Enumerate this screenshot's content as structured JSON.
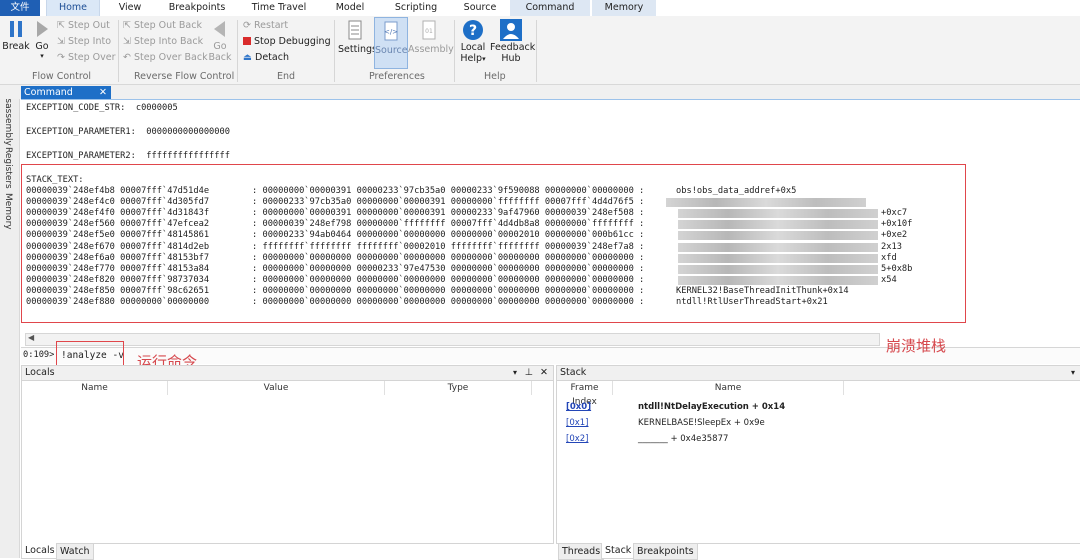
{
  "menu_tabs": {
    "file": "文件",
    "home": "Home",
    "view": "View",
    "breakpoints": "Breakpoints",
    "time_travel": "Time Travel",
    "model": "Model",
    "scripting": "Scripting",
    "source": "Source",
    "command": "Command",
    "memory": "Memory"
  },
  "ribbon": {
    "break": "Break",
    "go": "Go",
    "step_out": "Step Out",
    "step_into": "Step Into",
    "step_over": "Step Over",
    "step_out_back": "Step Out Back",
    "step_into_back": "Step Into Back",
    "step_over_back": "Step Over Back",
    "go_back_1": "Go",
    "go_back_2": "Back",
    "restart": "Restart",
    "stop_debugging": "Stop Debugging",
    "detach": "Detach",
    "settings": "Settings",
    "source": "Source",
    "assembly": "Assembly",
    "local_help_1": "Local",
    "local_help_2": "Help",
    "feedback_hub_1": "Feedback",
    "feedback_hub_2": "Hub",
    "groups": {
      "flow_control": "Flow Control",
      "reverse_flow_control": "Reverse Flow Control",
      "end": "End",
      "preferences": "Preferences",
      "help": "Help"
    }
  },
  "side_tabs": {
    "disassembly": "Disassembly",
    "registers": "Registers",
    "memory": "Memory"
  },
  "command_window": {
    "tab_title": "Command",
    "lines": [
      "EXCEPTION_CODE_STR:  c0000005",
      "",
      "EXCEPTION_PARAMETER1:  0000000000000000",
      "",
      "EXCEPTION_PARAMETER2:  ffffffffffffffff",
      "",
      "STACK_TEXT:"
    ],
    "stack_rows": [
      {
        "addr": "00000039`248ef4b8 00007fff`47d51d4e",
        "args": ": 00000000`00000391 00000233`97cb35a0 00000233`9f590088 00000000`00000000 :",
        "sym": "obs!obs_data_addref+0x5",
        "blur": false
      },
      {
        "addr": "00000039`248ef4c0 00007fff`4d305fd7",
        "args": ": 00000233`97cb35a0 00000000`00000391 00000000`ffffffff 00007fff`4d4d76f5 :",
        "sym": "",
        "blur": true
      },
      {
        "addr": "00000039`248ef4f0 00007fff`4d31843f",
        "args": ": 00000000`00000391 00000000`00000391 00000233`9af47960 00000039`248ef508 :",
        "sym": "+0xc7",
        "blur": true
      },
      {
        "addr": "00000039`248ef560 00007fff`47efcea2",
        "args": ": 00000039`248ef798 00000000`ffffffff 00007fff`4d4db8a8 00000000`ffffffff :",
        "sym": "+0x10f",
        "blur": true
      },
      {
        "addr": "00000039`248ef5e0 00007fff`48145861",
        "args": ": 00000233`94ab0464 00000000`00000000 00000000`00002010 00000000`000b61cc :",
        "sym": "+0xe2",
        "blur": true
      },
      {
        "addr": "00000039`248ef670 00007fff`4814d2eb",
        "args": ": ffffffff`ffffffff ffffffff`00002010 ffffffff`ffffffff 00000039`248ef7a8 :",
        "sym": "2x13",
        "blur": true
      },
      {
        "addr": "00000039`248ef6a0 00007fff`48153bf7",
        "args": ": 00000000`00000000 00000000`00000000 00000000`00000000 00000000`00000000 :",
        "sym": "xfd",
        "blur": true
      },
      {
        "addr": "00000039`248ef770 00007fff`48153a84",
        "args": ": 00000000`00000000 00000233`97e47530 00000000`00000000 00000000`00000000 :",
        "sym": "5+0x8b",
        "blur": true
      },
      {
        "addr": "00000039`248ef820 00007fff`98737034",
        "args": ": 00000000`00000000 00000000`00000000 00000000`00000000 00000000`00000000 :",
        "sym": "x54",
        "blur": true
      },
      {
        "addr": "00000039`248ef850 00007fff`98c62651",
        "args": ": 00000000`00000000 00000000`00000000 00000000`00000000 00000000`00000000 :",
        "sym": "KERNEL32!BaseThreadInitThunk+0x14",
        "blur": false
      },
      {
        "addr": "00000039`248ef880 00000000`00000000",
        "args": ": 00000000`00000000 00000000`00000000 00000000`00000000 00000000`00000000 :",
        "sym": "ntdll!RtlUserThreadStart+0x21",
        "blur": false
      }
    ],
    "prompt": "0:109>",
    "input_value": "!analyze -v"
  },
  "annotations": {
    "run_command": "运行命令",
    "crash_stack": "崩溃堆栈"
  },
  "locals_pane": {
    "title": "Locals",
    "columns": [
      "Name",
      "Value",
      "Type"
    ],
    "tabs": [
      "Locals",
      "Watch"
    ]
  },
  "stack_pane": {
    "title": "Stack",
    "columns": [
      "Frame Index",
      "Name"
    ],
    "rows": [
      {
        "index": "[0x0]",
        "name": "ntdll!NtDelayExecution + 0x14"
      },
      {
        "index": "[0x1]",
        "name": "KERNELBASE!SleepEx + 0x9e"
      },
      {
        "index": "[0x2]",
        "name": "_______ + 0x4e35877"
      }
    ],
    "tabs": [
      "Threads",
      "Stack",
      "Breakpoints"
    ]
  },
  "colors": {
    "accent": "#1f5fb4",
    "highlight_box": "#e0464b",
    "link": "#2346b7"
  }
}
